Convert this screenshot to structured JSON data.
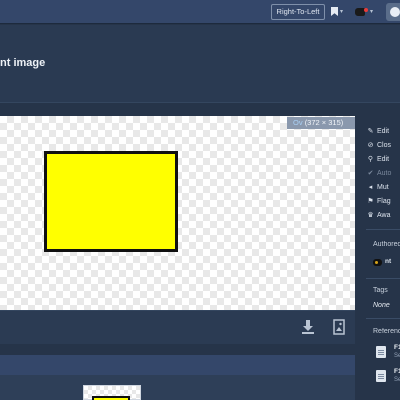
{
  "topbar": {
    "rtl_button": "Right-To-Left",
    "bookmark_icon": "bookmark-icon",
    "user_icon": "avatar-icon",
    "globe_icon": "globe-icon"
  },
  "page": {
    "title": "nt image"
  },
  "viewer": {
    "dims_link": "Ov",
    "dims_text": "(372 × 315)",
    "shape_color": "#ffff00",
    "download_icon": "download-icon",
    "image_icon": "image-icon"
  },
  "sidebar": {
    "actions": [
      {
        "icon": "pencil-icon",
        "label": "Edit",
        "disabled": false
      },
      {
        "icon": "close-circle-icon",
        "label": "Clos",
        "disabled": false
      },
      {
        "icon": "link-icon",
        "label": "Edit",
        "disabled": false
      },
      {
        "icon": "check-circle-icon",
        "label": "Auto",
        "disabled": true
      },
      {
        "icon": "volume-icon",
        "label": "Mut",
        "disabled": false
      },
      {
        "icon": "flag-icon",
        "label": "Flag",
        "disabled": false
      },
      {
        "icon": "trophy-icon",
        "label": "Awa",
        "disabled": false
      }
    ],
    "authored_heading": "Authored",
    "author_name": "nt",
    "tags_heading": "Tags",
    "tags_value": "None",
    "references_heading": "Reference",
    "references": [
      {
        "title": "F1",
        "sub": "Se"
      },
      {
        "title": "F1",
        "sub": "Se"
      }
    ]
  }
}
